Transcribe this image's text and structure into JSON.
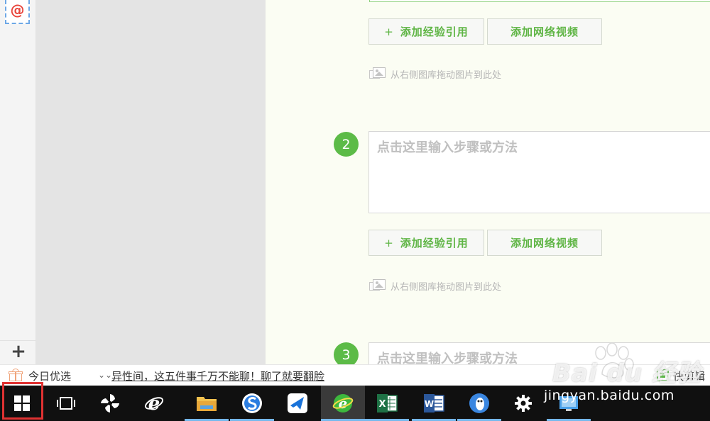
{
  "sidebar": {
    "stamp_icon": "email-stamp-icon",
    "add_label": "+"
  },
  "editor": {
    "add_ref_plus": "+",
    "add_ref_label": "添加经验引用",
    "add_video_label": "添加网络视频",
    "drag_hint": "从右侧图库拖动图片到此处",
    "step_placeholder": "点击这里输入步骤或方法",
    "steps": [
      "2",
      "3"
    ],
    "accent_color": "#5cbb47"
  },
  "newsbar": {
    "today_label": "今日优选",
    "headline": "异性间，这五件事千万不能聊！聊了就要翻脸",
    "clip_label": "快剪辑"
  },
  "watermark": {
    "brand": "Bai du 经验",
    "url": "jingyan.baidu.com"
  },
  "taskbar": {
    "items": [
      "windows-start",
      "task-view",
      "pinwheel-app",
      "internet-explorer",
      "file-explorer",
      "sogou-browser",
      "feishu",
      "360-browser",
      "excel",
      "word",
      "qq-browser",
      "settings",
      "control-panel"
    ]
  }
}
